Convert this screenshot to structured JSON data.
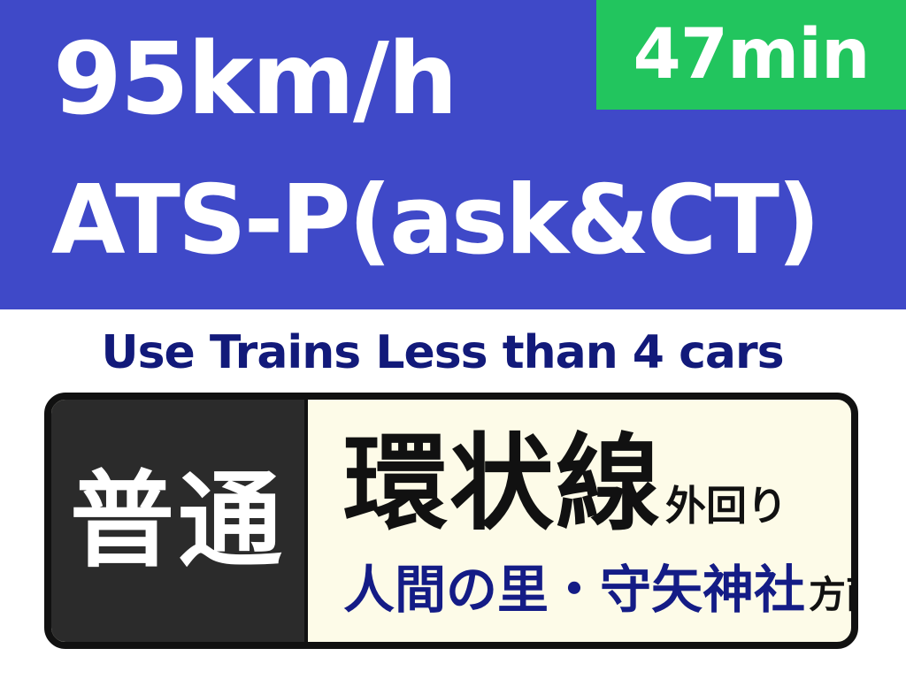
{
  "header": {
    "speed_limit": "95km/h",
    "safety_system": "ATS-P(ask&CT)",
    "duration": "47min"
  },
  "notice": {
    "text": "Use Trains Less than 4 cars"
  },
  "sign": {
    "service_type": "普通",
    "line_name": "環状線",
    "line_direction": "外回り",
    "destination": "人間の里・守矢神社",
    "destination_suffix": "方面"
  },
  "colors": {
    "header_background": "#3f49c8",
    "duration_badge": "#22c55e",
    "notice_text": "#121a7a",
    "sign_left_background": "#2b2b2b",
    "sign_right_background": "#fdfbe8",
    "destination_text": "#141c86"
  }
}
